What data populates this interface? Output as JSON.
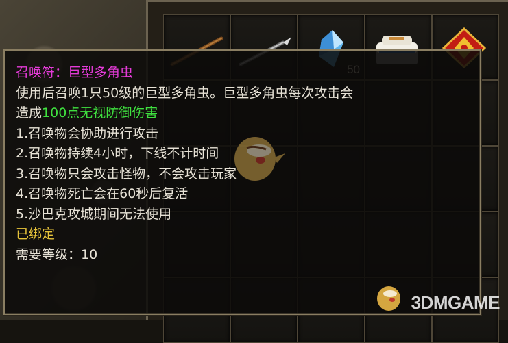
{
  "inventory": {
    "slots": [
      {
        "icon": "wooden-staff-icon"
      },
      {
        "icon": "iron-spear-icon"
      },
      {
        "icon": "blue-crystal-icon",
        "quantity": "50"
      },
      {
        "icon": "scroll-bundle-icon"
      },
      {
        "icon": "red-rune-talisman-icon"
      }
    ]
  },
  "tooltip": {
    "title": "召唤符：巨型多角虫",
    "desc_line1": "使用后召唤1只50级的巨型多角虫。巨型多角虫每次攻击会",
    "desc_line2_prefix": "造成",
    "desc_line2_highlight": "100点无视防御伤害",
    "effects": [
      "1.召唤物会协助进行攻击",
      "2.召唤物持续4小时，下线不计时间",
      "3.召唤物只会攻击怪物，不会攻击玩家",
      "4.召唤物死亡会在60秒后复活",
      "5.沙巴克攻城期间无法使用"
    ],
    "bound_status": "已绑定",
    "level_requirement": "需要等级：10"
  },
  "watermark": "3DMGAME",
  "colors": {
    "title": "#e43bd8",
    "highlight": "#3fe03f",
    "bound": "#e7c43a",
    "text": "#e7e2d6",
    "border": "#8a7e62"
  }
}
